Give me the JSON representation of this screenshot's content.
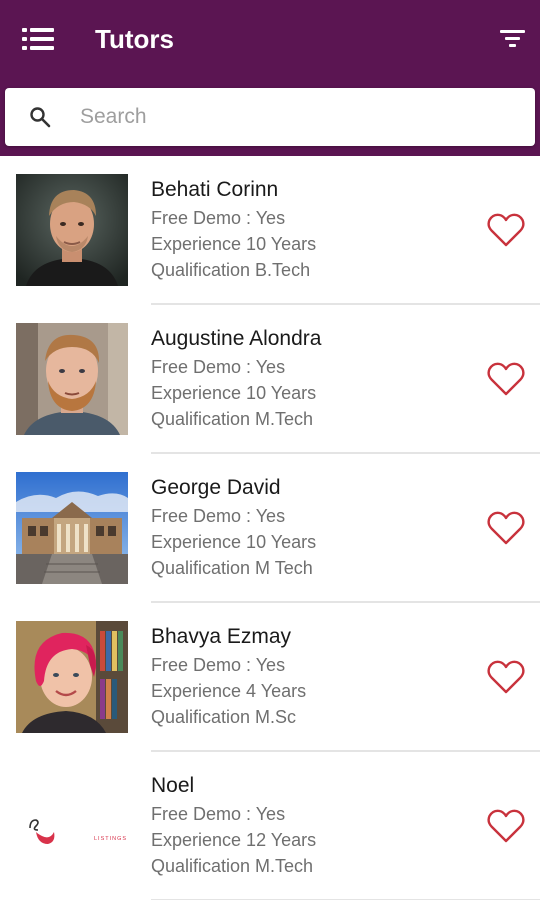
{
  "header": {
    "title": "Tutors",
    "background_color": "#5b1552",
    "menu_icon": "list-menu-icon",
    "filter_icon": "filter-icon"
  },
  "search": {
    "placeholder": "Search",
    "value": "",
    "icon": "search-icon"
  },
  "tutors": [
    {
      "name": "Behati Corinn",
      "free_demo": "Free Demo : Yes",
      "experience": "Experience 10 Years",
      "qualification": "Qualification B.Tech"
    },
    {
      "name": "Augustine Alondra",
      "free_demo": "Free Demo : Yes",
      "experience": "Experience 10 Years",
      "qualification": "Qualification M.Tech"
    },
    {
      "name": "George David",
      "free_demo": "Free Demo : Yes",
      "experience": "Experience 10 Years",
      "qualification": "Qualification M Tech"
    },
    {
      "name": "Bhavya Ezmay",
      "free_demo": "Free Demo : Yes",
      "experience": "Experience 4 Years",
      "qualification": "Qualification M.Sc"
    },
    {
      "name": "Noel",
      "free_demo": "Free Demo : Yes",
      "experience": "Experience 12 Years",
      "qualification": "Qualification M.Tech"
    }
  ],
  "favorite_icon": "heart-outline-icon",
  "favorite_color": "#c8323c",
  "logo_text": "LISTINGS"
}
